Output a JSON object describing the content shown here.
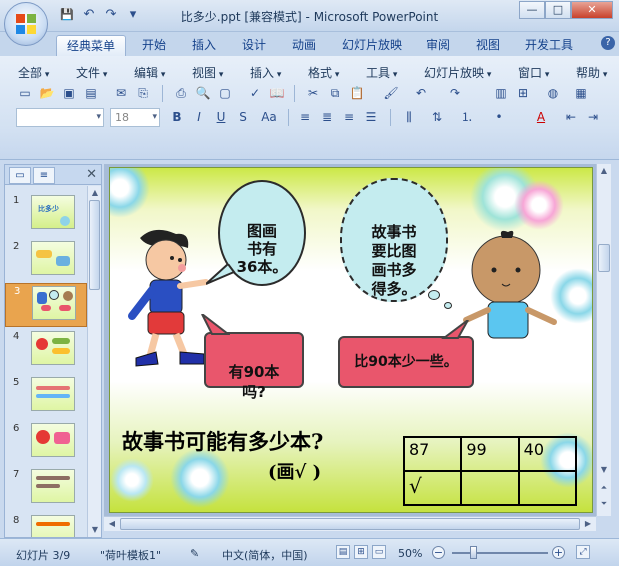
{
  "window": {
    "title": "比多少.ppt [兼容模式] - Microsoft PowerPoint",
    "minimize": "—",
    "maximize": "□",
    "close": "✕"
  },
  "qat": {
    "save": "💾",
    "undo": "↶",
    "redo": "↷",
    "customize": "▾"
  },
  "tabs": [
    "经典菜单",
    "开始",
    "插入",
    "设计",
    "动画",
    "幻灯片放映",
    "审阅",
    "视图",
    "开发工具"
  ],
  "help": "?",
  "menus": [
    "全部",
    "文件",
    "编辑",
    "视图",
    "插入",
    "格式",
    "工具",
    "幻灯片放映",
    "窗口",
    "帮助"
  ],
  "toolbar": {
    "font_name": "",
    "font_size": "18",
    "bold": "B",
    "italic": "I",
    "underline": "U",
    "shadow": "S",
    "change_case": "Aa"
  },
  "left_pane": {
    "close": "✕",
    "slides": [
      {
        "num": "1",
        "title": "比多少"
      },
      {
        "num": "2",
        "title": ""
      },
      {
        "num": "3",
        "title": ""
      },
      {
        "num": "4",
        "title": ""
      },
      {
        "num": "5",
        "title": ""
      },
      {
        "num": "6",
        "title": ""
      },
      {
        "num": "7",
        "title": ""
      },
      {
        "num": "8",
        "title": ""
      }
    ],
    "selected": "3"
  },
  "slide": {
    "speech1": "图画\n书有\n36本。",
    "thought": "故事书\n要比图\n画书多\n得多。",
    "pink1": "有90本\n吗?",
    "pink2": "比90本少一些。",
    "question": "故事书可能有多少本?",
    "hint": "(画√ )",
    "table": {
      "row1": [
        "87",
        "99",
        "40"
      ],
      "row2": [
        "√",
        "",
        ""
      ]
    }
  },
  "status": {
    "slide_info": "幻灯片 3/9",
    "theme": "\"荷叶模板1\"",
    "language": "中文(简体，中国)",
    "zoom": "50%"
  }
}
